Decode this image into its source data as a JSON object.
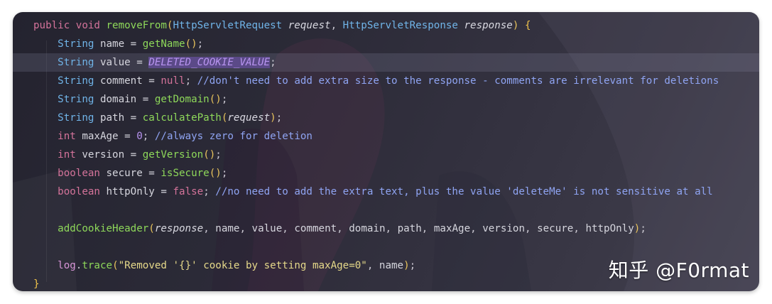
{
  "editor": {
    "lines": [
      [
        [
          "kw",
          "public void "
        ],
        [
          "fn",
          "removeFrom"
        ],
        [
          "paren",
          "("
        ],
        [
          "type",
          "HttpServletRequest "
        ],
        [
          "param",
          "request"
        ],
        [
          "punc",
          ", "
        ],
        [
          "type",
          "HttpServletResponse "
        ],
        [
          "param",
          "response"
        ],
        [
          "paren",
          ") "
        ],
        [
          "brace",
          "{"
        ]
      ],
      [
        [
          "plain",
          "    "
        ],
        [
          "type",
          "String "
        ],
        [
          "plain",
          "name = "
        ],
        [
          "fn",
          "getName"
        ],
        [
          "paren",
          "()"
        ],
        [
          "punc",
          ";"
        ]
      ],
      [
        [
          "plain",
          "    "
        ],
        [
          "type",
          "String "
        ],
        [
          "plain",
          "value = "
        ],
        [
          "constsel",
          "DELETED_COOKIE_VALUE"
        ],
        [
          "punc",
          ";"
        ]
      ],
      [
        [
          "plain",
          "    "
        ],
        [
          "type",
          "String "
        ],
        [
          "plain",
          "comment = "
        ],
        [
          "kw",
          "null"
        ],
        [
          "punc",
          "; "
        ],
        [
          "cmt",
          "//don't need to add extra size to the response - comments are irrelevant for deletions"
        ]
      ],
      [
        [
          "plain",
          "    "
        ],
        [
          "type",
          "String "
        ],
        [
          "plain",
          "domain = "
        ],
        [
          "fn",
          "getDomain"
        ],
        [
          "paren",
          "()"
        ],
        [
          "punc",
          ";"
        ]
      ],
      [
        [
          "plain",
          "    "
        ],
        [
          "type",
          "String "
        ],
        [
          "plain",
          "path = "
        ],
        [
          "fn",
          "calculatePath"
        ],
        [
          "paren",
          "("
        ],
        [
          "param",
          "request"
        ],
        [
          "paren",
          ")"
        ],
        [
          "punc",
          ";"
        ]
      ],
      [
        [
          "plain",
          "    "
        ],
        [
          "kw",
          "int "
        ],
        [
          "plain",
          "maxAge = "
        ],
        [
          "num",
          "0"
        ],
        [
          "punc",
          "; "
        ],
        [
          "cmt",
          "//always zero for deletion"
        ]
      ],
      [
        [
          "plain",
          "    "
        ],
        [
          "kw",
          "int "
        ],
        [
          "plain",
          "version = "
        ],
        [
          "fn",
          "getVersion"
        ],
        [
          "paren",
          "()"
        ],
        [
          "punc",
          ";"
        ]
      ],
      [
        [
          "plain",
          "    "
        ],
        [
          "kw",
          "boolean "
        ],
        [
          "plain",
          "secure = "
        ],
        [
          "fn",
          "isSecure"
        ],
        [
          "paren",
          "()"
        ],
        [
          "punc",
          ";"
        ]
      ],
      [
        [
          "plain",
          "    "
        ],
        [
          "kw",
          "boolean "
        ],
        [
          "plain",
          "httpOnly = "
        ],
        [
          "kw",
          "false"
        ],
        [
          "punc",
          "; "
        ],
        [
          "cmt",
          "//no need to add the extra text, plus the value 'deleteMe' is not sensitive at all"
        ]
      ],
      [],
      [
        [
          "plain",
          "    "
        ],
        [
          "fn",
          "addCookieHeader"
        ],
        [
          "paren",
          "("
        ],
        [
          "param",
          "response"
        ],
        [
          "punc",
          ", "
        ],
        [
          "plain",
          "name"
        ],
        [
          "punc",
          ", "
        ],
        [
          "plain",
          "value"
        ],
        [
          "punc",
          ", "
        ],
        [
          "plain",
          "comment"
        ],
        [
          "punc",
          ", "
        ],
        [
          "plain",
          "domain"
        ],
        [
          "punc",
          ", "
        ],
        [
          "plain",
          "path"
        ],
        [
          "punc",
          ", "
        ],
        [
          "plain",
          "maxAge"
        ],
        [
          "punc",
          ", "
        ],
        [
          "plain",
          "version"
        ],
        [
          "punc",
          ", "
        ],
        [
          "plain",
          "secure"
        ],
        [
          "punc",
          ", "
        ],
        [
          "plain",
          "httpOnly"
        ],
        [
          "paren",
          ")"
        ],
        [
          "punc",
          ";"
        ]
      ],
      [],
      [
        [
          "plain",
          "    "
        ],
        [
          "field",
          "log"
        ],
        [
          "punc",
          "."
        ],
        [
          "fn",
          "trace"
        ],
        [
          "paren",
          "("
        ],
        [
          "str",
          "\"Removed '{}' cookie by setting maxAge=0\""
        ],
        [
          "punc",
          ", "
        ],
        [
          "plain",
          "name"
        ],
        [
          "paren",
          ")"
        ],
        [
          "punc",
          ";"
        ]
      ],
      [
        [
          "brace",
          "}"
        ]
      ]
    ],
    "highlighted_line": 2
  },
  "watermark": "知乎 @F0rmat"
}
